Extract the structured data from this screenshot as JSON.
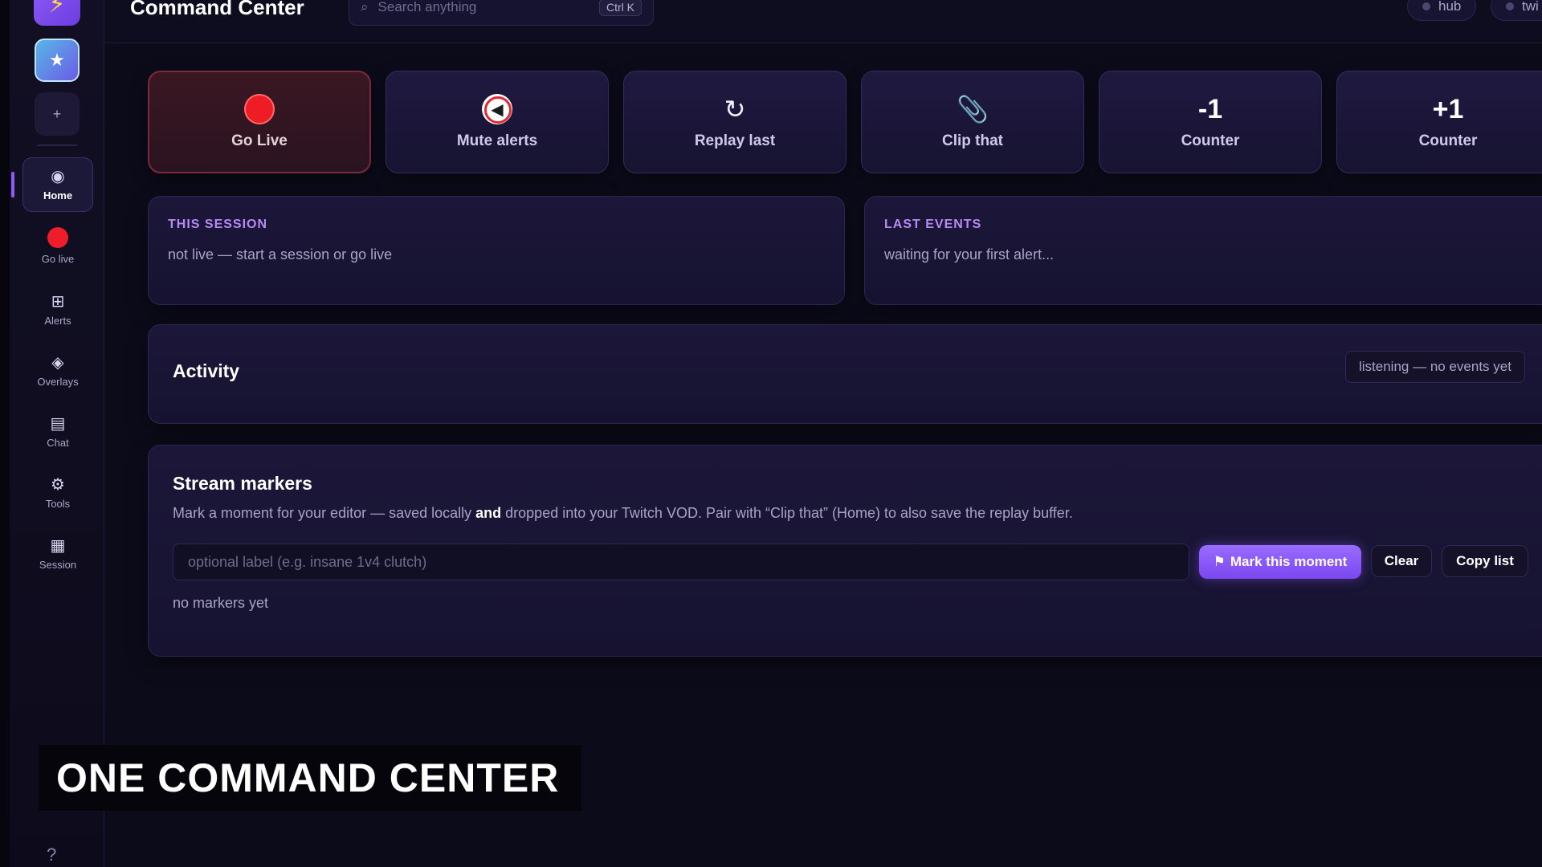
{
  "app": {
    "title": "Command Center"
  },
  "search": {
    "placeholder": "Search anything",
    "shortcut": "Ctrl K"
  },
  "topbar_pills": [
    {
      "label": "hub"
    },
    {
      "label": "twi"
    }
  ],
  "sidebar": {
    "logo_icon": "lightning-icon",
    "favorite_icon": "star-icon",
    "add_icon": "plus-icon",
    "items": [
      {
        "label": "Home",
        "icon": "home-icon",
        "active": true
      },
      {
        "label": "Go live",
        "icon": "red-dot-icon"
      },
      {
        "label": "Alerts",
        "icon": "grid-icon"
      },
      {
        "label": "Overlays",
        "icon": "diamond-icon"
      },
      {
        "label": "Chat",
        "icon": "chat-icon"
      },
      {
        "label": "Tools",
        "icon": "gear-icon"
      },
      {
        "label": "Session",
        "icon": "calendar-icon"
      }
    ],
    "help": "?"
  },
  "quick_actions": [
    {
      "label": "Go Live",
      "icon": "record-icon"
    },
    {
      "label": "Mute alerts",
      "icon": "mute-icon"
    },
    {
      "label": "Replay last",
      "icon": "replay-icon",
      "glyph": "↻"
    },
    {
      "label": "Clip that",
      "icon": "paperclip-icon",
      "glyph": "📎"
    },
    {
      "label": "Counter",
      "icon": "minus-one-icon",
      "glyph": "-1"
    },
    {
      "label": "Counter",
      "icon": "plus-one-icon",
      "glyph": "+1"
    }
  ],
  "session": {
    "eyebrow": "THIS SESSION",
    "text": "not live — start a session or go live"
  },
  "last_events": {
    "eyebrow": "LAST EVENTS",
    "text": "waiting for your first alert..."
  },
  "activity": {
    "title": "Activity",
    "status": "listening — no events yet"
  },
  "markers": {
    "title": "Stream markers",
    "desc_before": "Mark a moment for your editor — saved locally ",
    "desc_bold": "and",
    "desc_after": " dropped into your Twitch VOD. Pair with “Clip that” (Home) to also save the replay buffer.",
    "input_placeholder": "optional label (e.g. insane 1v4 clutch)",
    "mark_button": "Mark this moment",
    "clear_button": "Clear",
    "copy_button": "Copy list",
    "empty": "no markers yet"
  },
  "caption": "ONE COMMAND CENTER",
  "colors": {
    "accent": "#8b5cf6",
    "live_red": "#ee1c25",
    "eyebrow": "#b78af5",
    "background": "#0c0b1a"
  }
}
